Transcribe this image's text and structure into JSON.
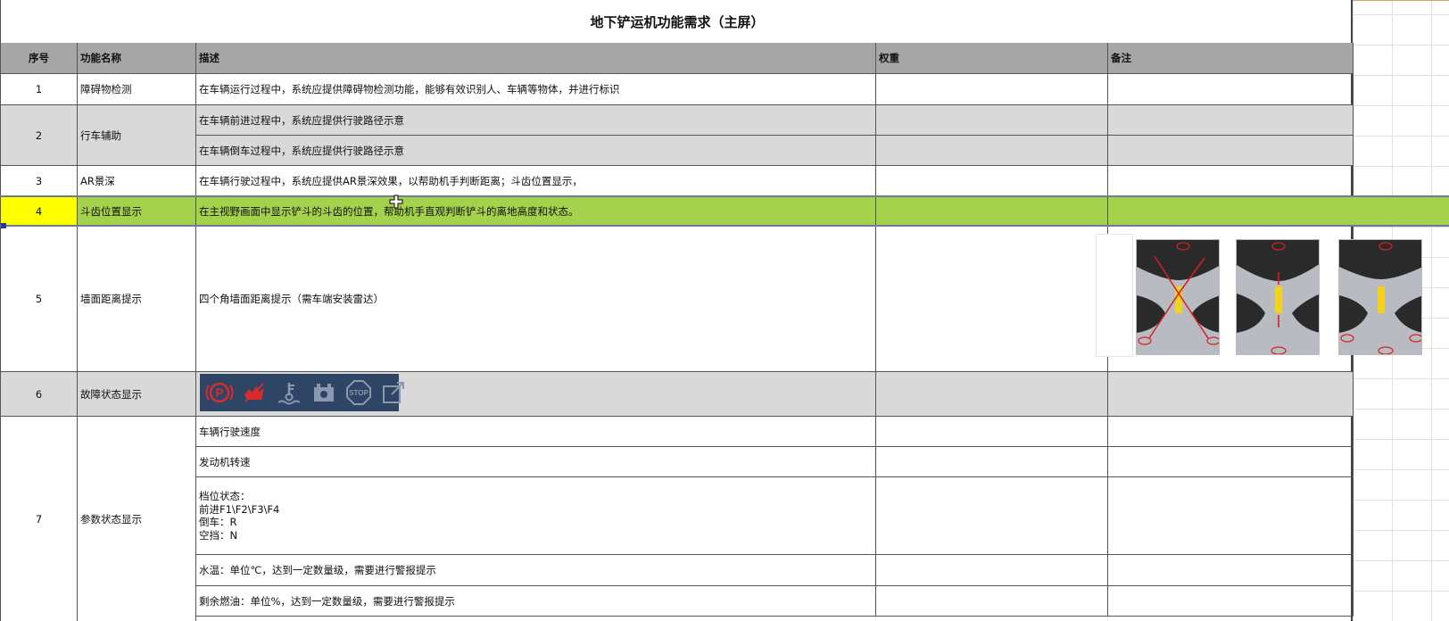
{
  "sheet": {
    "title": "地下铲运机功能需求（主屏）",
    "headers": {
      "seq": "序号",
      "function_name": "功能名称",
      "description": "描述",
      "weight": "权重",
      "remark": "备注"
    },
    "rows": [
      {
        "seq": "1",
        "name": "障碍物检测",
        "desc": "在车辆运行过程中，系统应提供障碍物检测功能，能够有效识别人、车辆等物体，并进行标识"
      },
      {
        "seq": "2",
        "name": "行车辅助",
        "desc_lines": [
          "在车辆前进过程中，系统应提供行驶路径示意",
          "在车辆倒车过程中，系统应提供行驶路径示意"
        ]
      },
      {
        "seq": "3",
        "name": "AR景深",
        "desc": "在车辆行驶过程中，系统应提供AR景深效果，以帮助机手判断距离；斗齿位置显示，"
      },
      {
        "seq": "4",
        "name": "斗齿位置显示",
        "desc": "在主视野画面中显示铲斗的斗齿的位置，帮助机手直观判断铲斗的离地高度和状态。"
      },
      {
        "seq": "5",
        "name": "墙面距离提示",
        "desc": "四个角墙面距离提示（需车端安装雷达）"
      },
      {
        "seq": "6",
        "name": "故障状态显示",
        "icons": [
          "parking-brake-icon",
          "engine-fault-icon",
          "coolant-temp-icon",
          "battery-icon",
          "stop-icon",
          "external-link-icon"
        ]
      },
      {
        "seq": "7",
        "name": "参数状态显示",
        "desc_lines": [
          "车辆行驶速度",
          "发动机转速",
          "档位状态：\n前进F1\\F2\\F3\\F4\n倒车：R\n空挡：N",
          "水温：单位℃，达到一定数量级，需要进行警报提示",
          "剩余燃油：单位%，达到一定数量级，需要进行警报提示"
        ]
      }
    ]
  },
  "colors": {
    "header_bg": "#a6a6a6",
    "gray_row": "#d9d9d9",
    "selected_row": "#a5d24c",
    "active_cell": "#ffff00",
    "fault_strip_bg": "#2e4566",
    "fault_icon_red": "#d92b2b",
    "fault_icon_gray": "#8a99ad"
  }
}
